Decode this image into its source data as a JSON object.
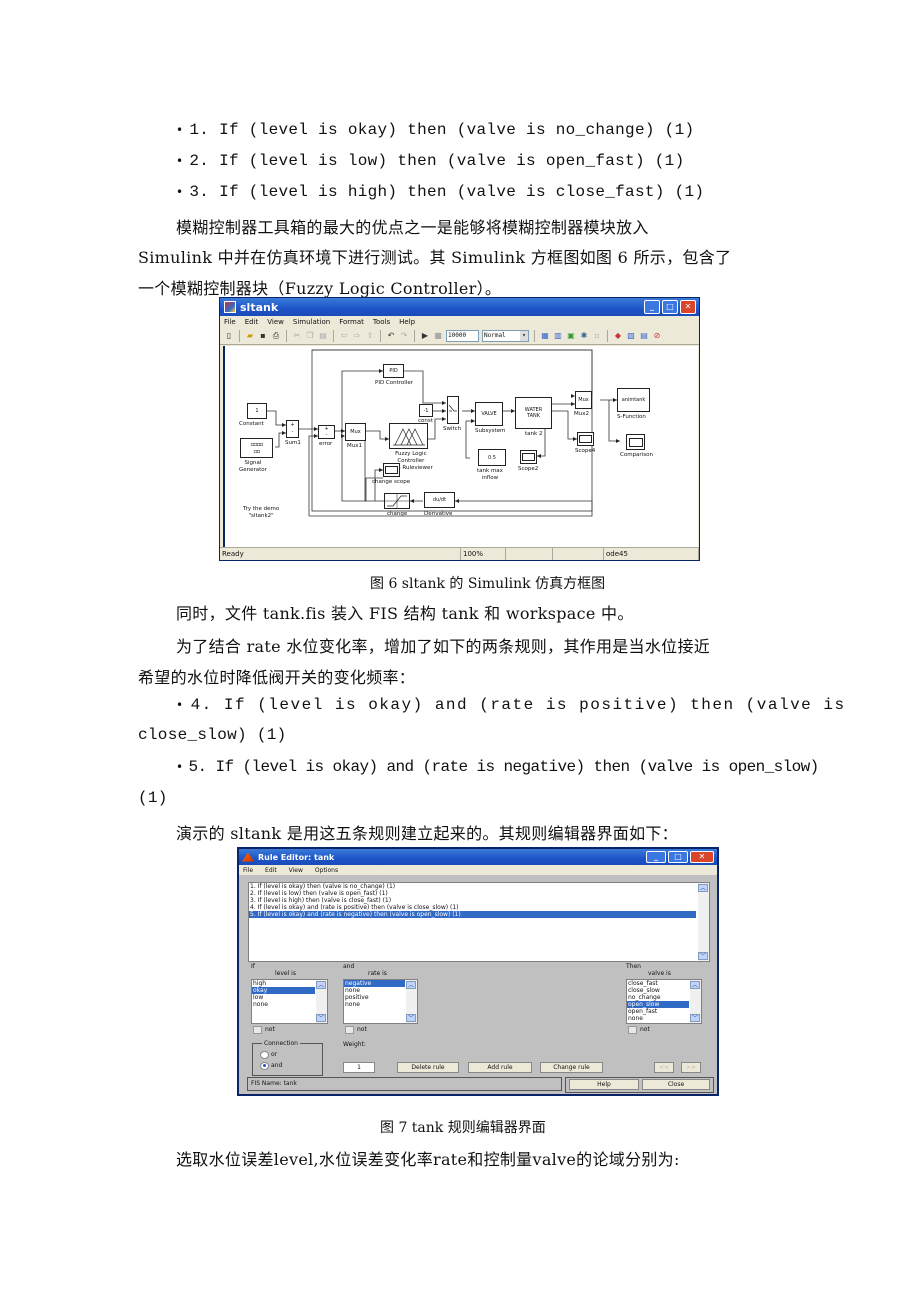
{
  "rules_intro": [
    {
      "bullet": "1. If (level is okay) then (valve is no_change) (1)"
    },
    {
      "bullet": "2. If (level is low) then (valve is open_fast) (1)"
    },
    {
      "bullet": "3. If (level is high) then (valve is close_fast) (1)"
    }
  ],
  "paragraph1": {
    "line1": "模糊控制器工具箱的最大的优点之一是能够将模糊控制器模块放入",
    "line2": "Simulink 中并在仿真环境下进行测试。其 Simulink 方框图如图 6 所示，包含了",
    "line3": "一个模糊控制器块（Fuzzy Logic Controller）。"
  },
  "simulink_window": {
    "title": "sltank",
    "menu": [
      "File",
      "Edit",
      "View",
      "Simulation",
      "Format",
      "Tools",
      "Help"
    ],
    "toolbar": {
      "stop_time": "10000",
      "sim_mode": "Normal",
      "icons": [
        "new-icon",
        "open-icon",
        "save-icon",
        "print-icon",
        "cut-icon",
        "copy-icon",
        "paste-icon",
        "back-icon",
        "forward-icon",
        "up-icon",
        "undo-icon",
        "redo-icon",
        "play-icon",
        "stop-icon",
        "library-icon",
        "model-explorer-icon",
        "debug-icon",
        "build-icon",
        "settings-icon",
        "browser-icon",
        "diagnostics-icon",
        "refresh-icon",
        "help-icon"
      ]
    },
    "blocks": {
      "constant": {
        "value": "1",
        "label": "Constant"
      },
      "signal_generator": {
        "label": "Signal\nGenerator"
      },
      "sum1": {
        "label": "Sum1",
        "signs": "+\n-"
      },
      "error": {
        "label": "error",
        "signs": "+\n-"
      },
      "pid": {
        "value": "PID",
        "label": "PID Controller"
      },
      "mux1": {
        "value": "Mux",
        "label": "Mux1"
      },
      "fuzzy": {
        "label": "Fuzzy Logic\nController\nwith Ruleviewer"
      },
      "const": {
        "value": "-1",
        "label": "const"
      },
      "switch": {
        "label": "Switch"
      },
      "valve": {
        "value": "VALVE",
        "label": "Subsystem"
      },
      "water_tank": {
        "value": "WATER\nTANK",
        "label": "tank 2"
      },
      "tank_max": {
        "value": "0.5",
        "label": "tank max\ninflow"
      },
      "scope2": {
        "label": "Scope2"
      },
      "mux2": {
        "value": "Mux",
        "label": "Mux2"
      },
      "scope4": {
        "label": "Scope4"
      },
      "animtank": {
        "value": "animtank",
        "label": "S-Function"
      },
      "comparison": {
        "label": "Comparison"
      },
      "change_scope": {
        "label": "change scope"
      },
      "change": {
        "label": "change"
      },
      "derivative": {
        "value": "du/dt",
        "label": "Derivative"
      },
      "demo_note": "Try the demo\n\"sltank2\""
    },
    "status": {
      "state": "Ready",
      "zoom": "100%",
      "solver": "ode45"
    }
  },
  "figure6_caption": "图 6   sltank 的 Simulink 仿真方框图",
  "paragraph2": "同时，文件 tank.fis 装入 FIS 结构 tank 和 workspace 中。",
  "paragraph3": {
    "line1": "为了结合 rate 水位变化率，增加了如下的两条规则，其作用是当水位接近",
    "line2": "希望的水位时降低阀开关的变化频率："
  },
  "rules_added": [
    {
      "line1": "4. If (level is okay) and (rate is positive) then (valve is",
      "line2": "close_slow) (1)"
    },
    {
      "line1": "5. If (level is okay) and (rate is negative) then (valve is open_slow)",
      "line2": "(1)"
    }
  ],
  "paragraph4": "演示的 sltank 是用这五条规则建立起来的。其规则编辑器界面如下：",
  "rule_editor": {
    "title": "Rule Editor: tank",
    "menu": [
      "File",
      "Edit",
      "View",
      "Options"
    ],
    "rules": [
      "1. If (level is okay) then (valve is no_change) (1)",
      "2. If (level is low) then (valve is open_fast) (1)",
      "3. If (level is high) then (valve is close_fast) (1)",
      "4. If (level is okay) and (rate is positive) then (valve is close_slow) (1)",
      "5. If (level is okay) and (rate is negative) then (valve is open_slow) (1)"
    ],
    "selected_rule": 4,
    "if_label": "If",
    "level_label": "level is",
    "level_options": [
      "high",
      "okay",
      "low",
      "none"
    ],
    "level_selected": 1,
    "and_label": "and",
    "rate_label": "rate is",
    "rate_options": [
      "negative",
      "none",
      "positive",
      "none"
    ],
    "rate_selected": 0,
    "then_label": "Then",
    "valve_label": "valve is",
    "valve_options": [
      "close_fast",
      "close_slow",
      "no_change",
      "open_slow",
      "open_fast",
      "none"
    ],
    "valve_selected": 3,
    "not_label": "not",
    "connection_label": "Connection",
    "connection_options": [
      "or",
      "and"
    ],
    "connection_selected": "and",
    "weight_label": "Weight:",
    "weight_value": "1",
    "buttons": {
      "delete": "Delete rule",
      "add": "Add rule",
      "change": "Change rule",
      "prev": "<<",
      "next": ">>",
      "help": "Help",
      "close": "Close"
    },
    "status": "FIS Name: tank"
  },
  "figure7_caption": "图 7   tank 规则编辑器界面",
  "paragraph5": "选取水位误差level,水位误差变化率rate和控制量valve的论域分别为:"
}
